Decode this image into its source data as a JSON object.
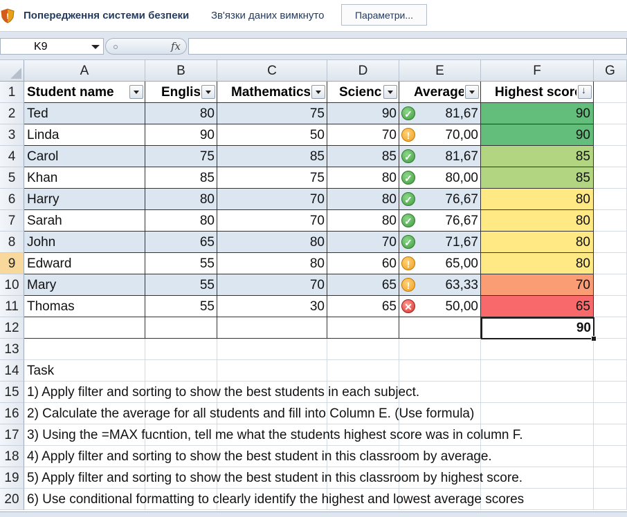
{
  "security_bar": {
    "title": "Попередження системи безпеки",
    "message": "Зв'язки даних вимкнуто",
    "button_label": "Параметри..."
  },
  "formula_bar": {
    "name_box": "K9",
    "fx_label": "fx",
    "formula": ""
  },
  "columns": [
    "A",
    "B",
    "C",
    "D",
    "E",
    "F",
    "G"
  ],
  "rows": [
    "1",
    "2",
    "3",
    "4",
    "5",
    "6",
    "7",
    "8",
    "9",
    "10",
    "11",
    "12",
    "13",
    "14",
    "15",
    "16",
    "17",
    "18",
    "19",
    "20"
  ],
  "selected_row": "9",
  "table": {
    "headers": [
      "Student name",
      "English",
      "Mathematics",
      "Science",
      "Average",
      "Highest score"
    ],
    "records": [
      {
        "name": "Ted",
        "english": "80",
        "math": "75",
        "science": "90",
        "icon": "check-icon",
        "average": "81,67",
        "highest": "90",
        "color": "#63be7b"
      },
      {
        "name": "Linda",
        "english": "90",
        "math": "50",
        "science": "70",
        "icon": "warning-icon",
        "average": "70,00",
        "highest": "90",
        "color": "#63be7b"
      },
      {
        "name": "Carol",
        "english": "75",
        "math": "85",
        "science": "85",
        "icon": "check-icon",
        "average": "81,67",
        "highest": "85",
        "color": "#b1d580"
      },
      {
        "name": "Khan",
        "english": "85",
        "math": "75",
        "science": "80",
        "icon": "check-icon",
        "average": "80,00",
        "highest": "85",
        "color": "#b1d580"
      },
      {
        "name": "Harry",
        "english": "80",
        "math": "70",
        "science": "80",
        "icon": "check-icon",
        "average": "76,67",
        "highest": "80",
        "color": "#ffe984"
      },
      {
        "name": "Sarah",
        "english": "80",
        "math": "70",
        "science": "80",
        "icon": "check-icon",
        "average": "76,67",
        "highest": "80",
        "color": "#ffe984"
      },
      {
        "name": "John",
        "english": "65",
        "math": "80",
        "science": "70",
        "icon": "check-icon",
        "average": "71,67",
        "highest": "80",
        "color": "#ffe984"
      },
      {
        "name": "Edward",
        "english": "55",
        "math": "80",
        "science": "60",
        "icon": "warning-icon",
        "average": "65,00",
        "highest": "80",
        "color": "#ffe984"
      },
      {
        "name": "Mary",
        "english": "55",
        "math": "70",
        "science": "65",
        "icon": "warning-icon",
        "average": "63,33",
        "highest": "70",
        "color": "#fa9d75"
      },
      {
        "name": "Thomas",
        "english": "55",
        "math": "30",
        "science": "65",
        "icon": "error-icon",
        "average": "50,00",
        "highest": "65",
        "color": "#f8696b"
      }
    ],
    "max_value": "90"
  },
  "task": {
    "heading": "Task",
    "lines": [
      "1) Apply filter and sorting to show the best students in each subject.",
      "2) Calculate the average for all students and fill into Column E. (Use formula)",
      "3) Using the =MAX fucntion, tell me what the students highest score was in column F.",
      "4) Apply filter and sorting to show the best student in this classroom by average.",
      "5) Apply filter and sorting to show the best student in this classroom by highest score.",
      "6) Use conditional formatting to clearly identify the highest and lowest average scores"
    ]
  }
}
